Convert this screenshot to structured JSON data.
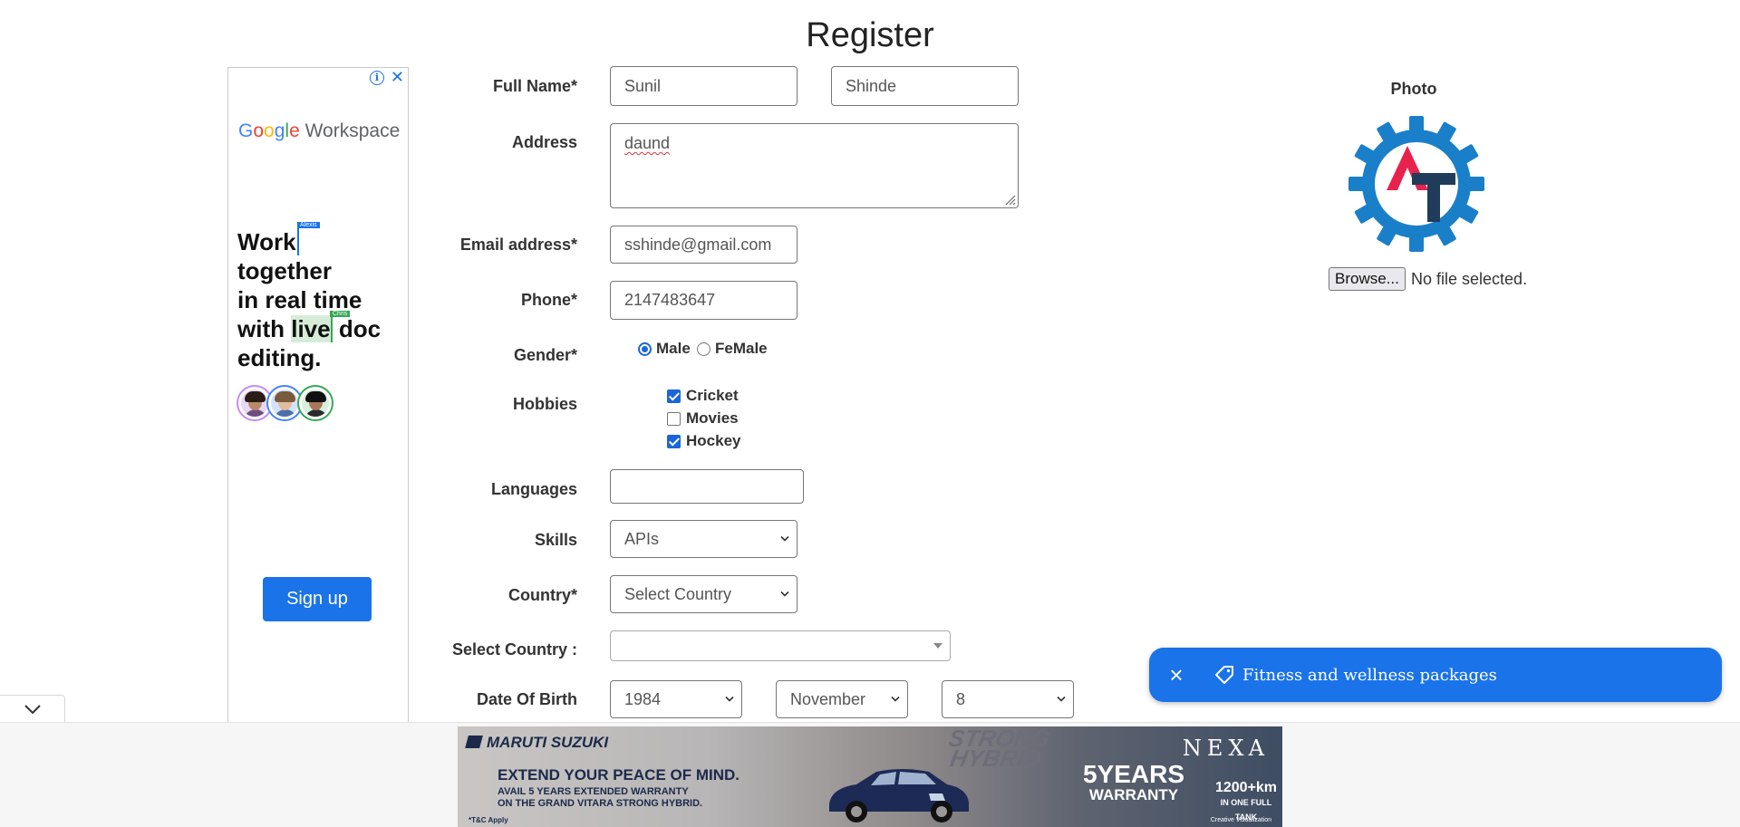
{
  "page": {
    "title": "Register"
  },
  "form": {
    "full_name_label": "Full Name*",
    "first_name": "Sunil",
    "last_name": "Shinde",
    "address_label": "Address",
    "address": "daund",
    "email_label": "Email address*",
    "email": "sshinde@gmail.com",
    "phone_label": "Phone*",
    "phone": "2147483647",
    "gender_label": "Gender*",
    "gender_options": [
      "Male",
      "FeMale"
    ],
    "gender_selected": "Male",
    "hobbies_label": "Hobbies",
    "hobbies": [
      {
        "label": "Cricket",
        "checked": true
      },
      {
        "label": "Movies",
        "checked": false
      },
      {
        "label": "Hockey",
        "checked": true
      }
    ],
    "languages_label": "Languages",
    "languages_value": "",
    "skills_label": "Skills",
    "skills_value": "APIs",
    "country_label": "Country*",
    "country_value": "Select Country",
    "select_country_label": "Select Country :",
    "select_country_value": "",
    "dob_label": "Date Of Birth",
    "dob_year": "1984",
    "dob_month": "November",
    "dob_day": "8"
  },
  "photo": {
    "label": "Photo",
    "browse_label": "Browse...",
    "file_status": "No file selected."
  },
  "side_ad": {
    "brand_google": "Google",
    "brand_product": "Workspace",
    "headline_1": "Work",
    "headline_2": "together",
    "headline_3": "in real time",
    "headline_4a": "with",
    "headline_4b": "live",
    "headline_4c": "doc",
    "headline_5": "editing.",
    "cursor_tag_1": "Alexis",
    "cursor_tag_2": "Chris",
    "cta": "Sign up"
  },
  "chip": {
    "text": "Fitness and wellness packages"
  },
  "bottom_ad": {
    "brand": "MARUTI SUZUKI",
    "tagline": "EXTEND YOUR PEACE OF MIND.",
    "sub1": "AVAIL 5 YEARS EXTENDED WARRANTY",
    "sub2": "ON THE GRAND VITARA STRONG HYBRID.",
    "strong": "STRONG",
    "hybrid": "HYBRID",
    "nexa": "NEXA",
    "warranty_years": "5YEARS",
    "warranty_word": "WARRANTY",
    "km": "1200+km",
    "km_sub": "IN ONE FULL TANK",
    "tc": "*T&C Apply",
    "cv": "Creative Visualization"
  },
  "colors": {
    "accent_blue": "#1a73e8",
    "check_blue": "#1a66d9",
    "logo_gear": "#1a7fc9",
    "logo_a": "#e8224d",
    "logo_t": "#1f3d5a"
  }
}
